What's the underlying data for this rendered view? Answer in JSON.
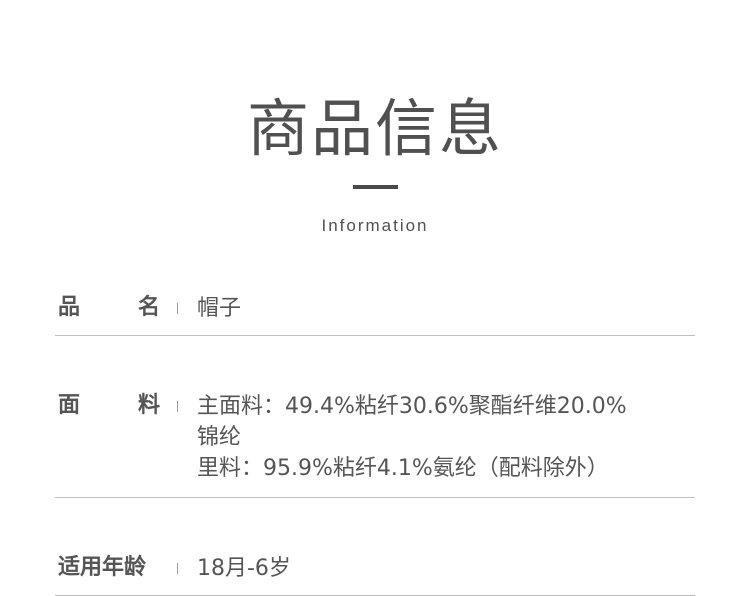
{
  "header": {
    "title": "商品信息",
    "subtitle": "Information"
  },
  "rows": [
    {
      "label_chars": [
        "品",
        "名"
      ],
      "value_lines": [
        "帽子"
      ]
    },
    {
      "label_chars": [
        "面",
        "料"
      ],
      "value_lines": [
        "主面料：49.4%粘纤30.6%聚酯纤维20.0%",
        "锦纶",
        "里料：95.9%粘纤4.1%氨纶（配料除外）"
      ]
    },
    {
      "label": "适用年龄",
      "value_lines": [
        "18月-6岁"
      ]
    }
  ]
}
